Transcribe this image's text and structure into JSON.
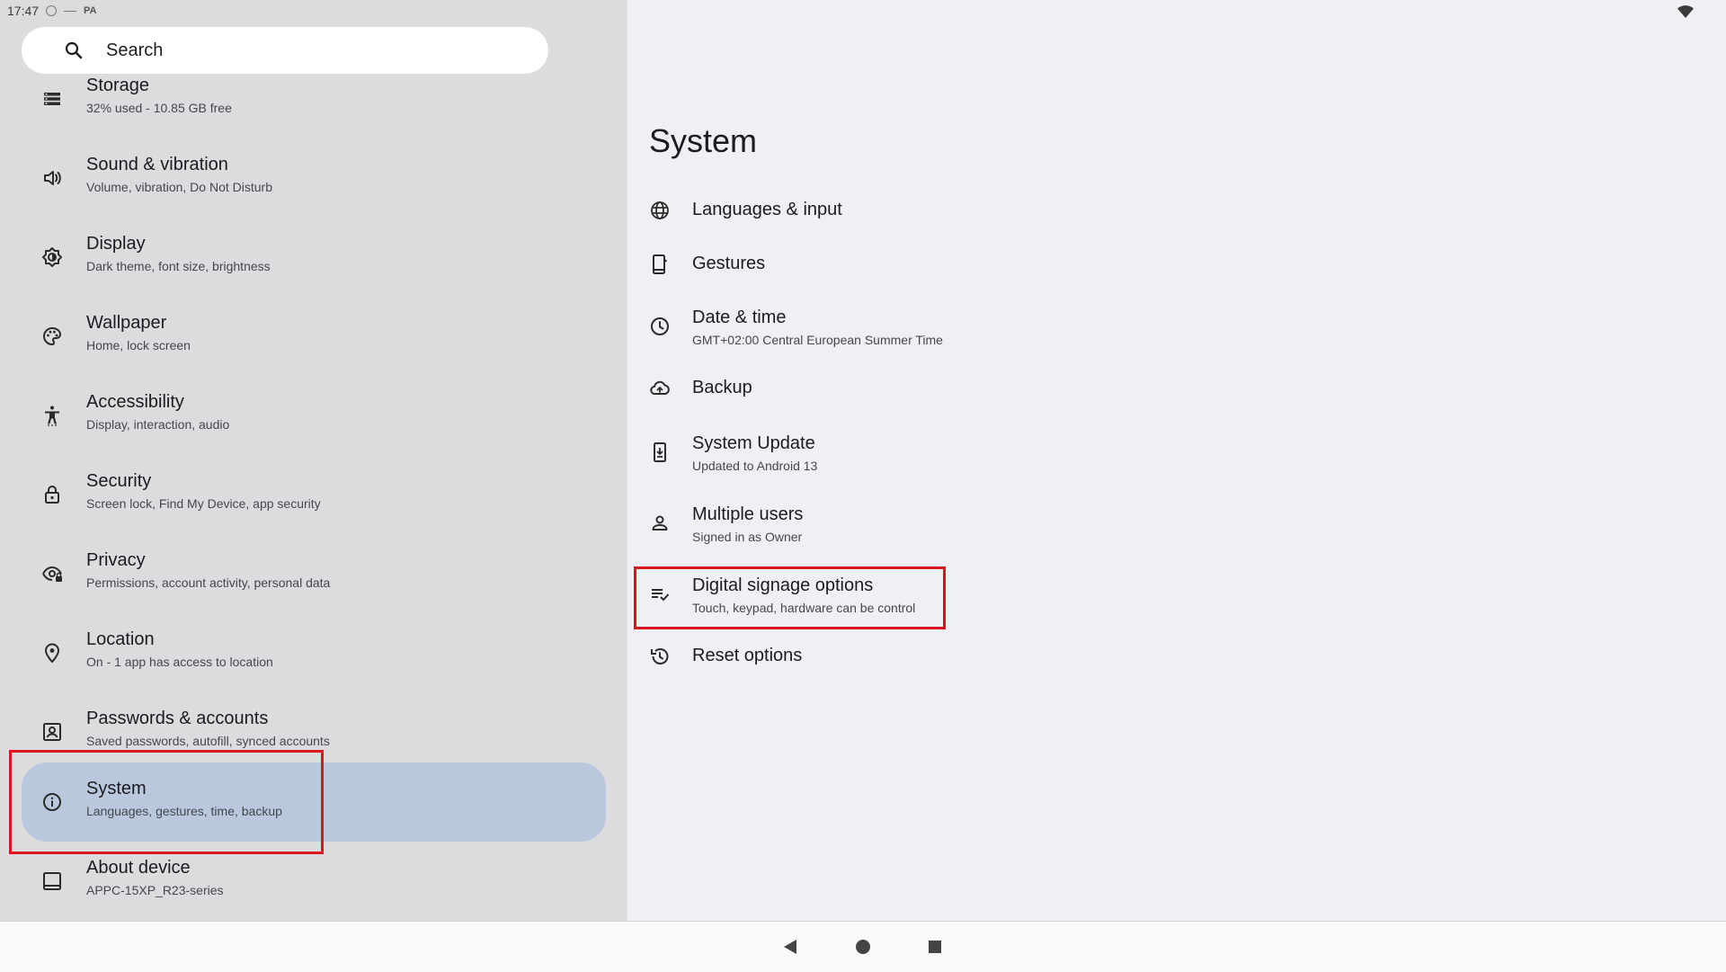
{
  "status_bar": {
    "time": "17:47",
    "carrier": "PA"
  },
  "search": {
    "label": "Search",
    "icon": "search-icon"
  },
  "sidebar": {
    "items": [
      {
        "title": "Storage",
        "subtitle": "32% used - 10.85 GB free",
        "icon": "storage-icon"
      },
      {
        "title": "Sound & vibration",
        "subtitle": "Volume, vibration, Do Not Disturb",
        "icon": "volume-icon"
      },
      {
        "title": "Display",
        "subtitle": "Dark theme, font size, brightness",
        "icon": "brightness-icon"
      },
      {
        "title": "Wallpaper",
        "subtitle": "Home, lock screen",
        "icon": "palette-icon"
      },
      {
        "title": "Accessibility",
        "subtitle": "Display, interaction, audio",
        "icon": "accessibility-icon"
      },
      {
        "title": "Security",
        "subtitle": "Screen lock, Find My Device, app security",
        "icon": "lock-icon"
      },
      {
        "title": "Privacy",
        "subtitle": "Permissions, account activity, personal data",
        "icon": "privacy-eye-icon"
      },
      {
        "title": "Location",
        "subtitle": "On - 1 app has access to location",
        "icon": "location-pin-icon"
      },
      {
        "title": "Passwords & accounts",
        "subtitle": "Saved passwords, autofill, synced accounts",
        "icon": "account-box-icon"
      },
      {
        "title": "System",
        "subtitle": "Languages, gestures, time, backup",
        "icon": "info-icon",
        "selected": true
      },
      {
        "title": "About device",
        "subtitle": "APPC-15XP_R23-series",
        "icon": "tablet-icon"
      }
    ]
  },
  "main": {
    "title": "System",
    "items": [
      {
        "title": "Languages & input",
        "subtitle": "",
        "icon": "globe-icon"
      },
      {
        "title": "Gestures",
        "subtitle": "",
        "icon": "gesture-phone-icon"
      },
      {
        "title": "Date & time",
        "subtitle": "GMT+02:00 Central European Summer Time",
        "icon": "clock-icon"
      },
      {
        "title": "Backup",
        "subtitle": "",
        "icon": "cloud-upload-icon"
      },
      {
        "title": "System Update",
        "subtitle": "Updated to Android 13",
        "icon": "system-update-icon"
      },
      {
        "title": "Multiple users",
        "subtitle": "Signed in as Owner",
        "icon": "person-icon"
      },
      {
        "title": "Digital signage options",
        "subtitle": "Touch, keypad, hardware can be control",
        "icon": "playlist-check-icon"
      },
      {
        "title": "Reset options",
        "subtitle": "",
        "icon": "history-icon"
      }
    ]
  },
  "nav_bar": {
    "back": "back-icon",
    "home": "home-icon",
    "recents": "recents-icon"
  },
  "colors": {
    "sidebar_bg": "#dcdcde",
    "selected_bg": "#b9c8dc",
    "content_bg": "#f0eff4",
    "highlight": "#d9151e"
  }
}
